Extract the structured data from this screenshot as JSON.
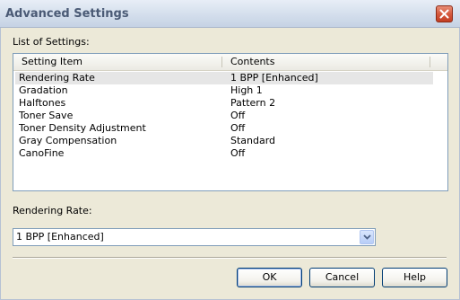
{
  "window": {
    "title": "Advanced Settings"
  },
  "list": {
    "label": "List of Settings:",
    "columns": [
      "Setting Item",
      "Contents"
    ],
    "rows": [
      {
        "item": "Rendering Rate",
        "contents": "1 BPP [Enhanced]",
        "selected": true
      },
      {
        "item": "Gradation",
        "contents": "High 1"
      },
      {
        "item": "Halftones",
        "contents": "Pattern 2"
      },
      {
        "item": "Toner Save",
        "contents": "Off"
      },
      {
        "item": "Toner Density Adjustment",
        "contents": "Off"
      },
      {
        "item": "Gray Compensation",
        "contents": "Standard"
      },
      {
        "item": "CanoFine",
        "contents": "Off"
      }
    ]
  },
  "rendering": {
    "label": "Rendering Rate:",
    "selected_value": "1 BPP [Enhanced]"
  },
  "buttons": {
    "ok": "OK",
    "cancel": "Cancel",
    "help": "Help"
  },
  "icons": {
    "close": "close-icon",
    "dropdown": "chevron-down-icon"
  }
}
